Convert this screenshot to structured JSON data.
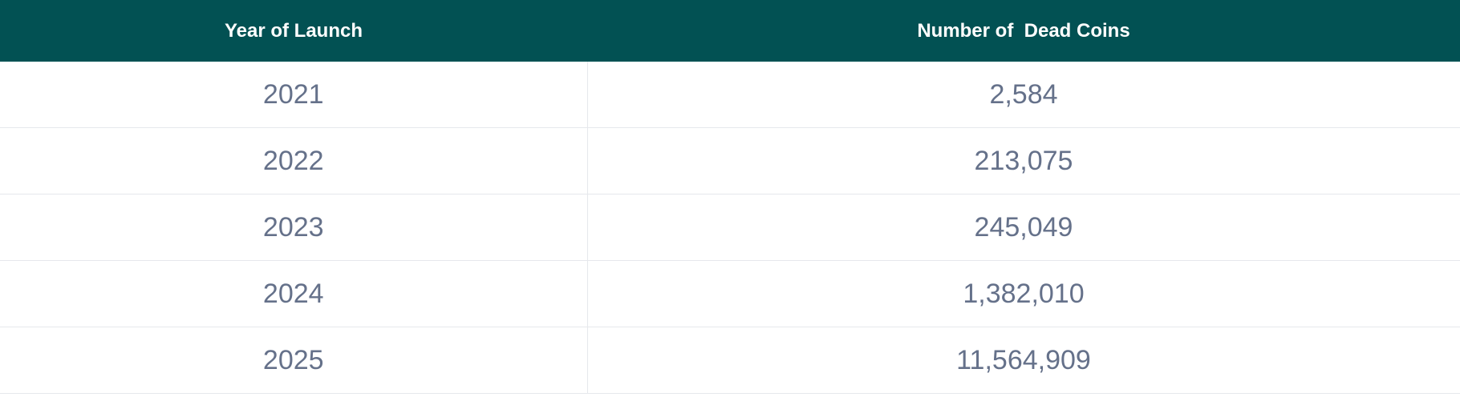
{
  "table": {
    "headers": [
      "Year of Launch",
      "Number of  Dead Coins"
    ],
    "rows": [
      [
        "2021",
        "2,584"
      ],
      [
        "2022",
        "213,075"
      ],
      [
        "2023",
        "245,049"
      ],
      [
        "2024",
        "1,382,010"
      ],
      [
        "2025",
        "11,564,909"
      ]
    ]
  },
  "colors": {
    "header_background": "#025153",
    "header_text": "#ffffff",
    "cell_text": "#65718a",
    "border": "#e6e8ec"
  }
}
